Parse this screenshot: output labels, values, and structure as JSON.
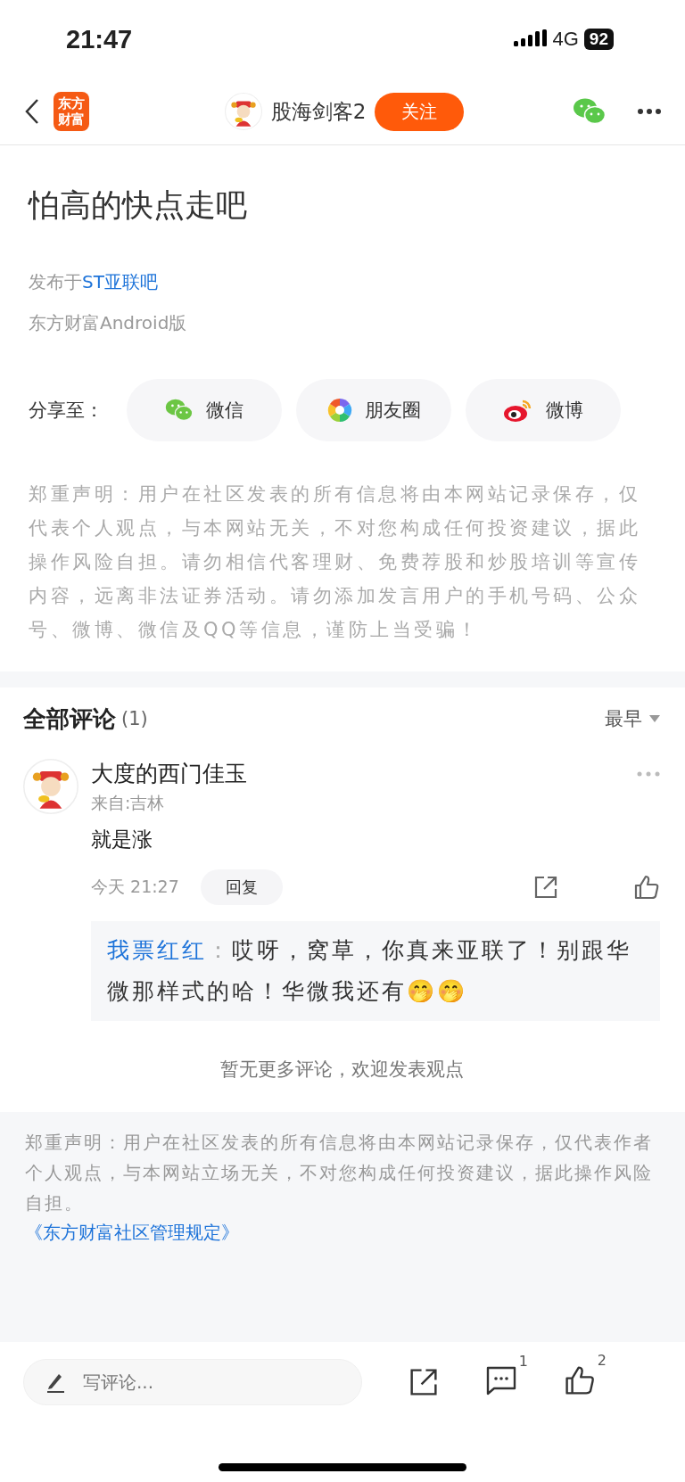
{
  "status_bar": {
    "time": "21:47",
    "network": "4G",
    "battery": "92"
  },
  "header": {
    "logo": "东方财富",
    "author": "股海剑客2",
    "follow_button": "关注"
  },
  "article": {
    "title_lines": [
      "怕高的快点走吧"
    ],
    "published_prefix": "发布于",
    "published_link": "ST亚联吧",
    "source": "东方财富Android版"
  },
  "share": {
    "label": "分享至：",
    "targets": [
      {
        "kind": "wechat",
        "label": "微信"
      },
      {
        "kind": "moments",
        "label": "朋友圈"
      },
      {
        "kind": "weibo",
        "label": "微博"
      }
    ]
  },
  "disclaimer": "郑重声明：用户在社区发表的所有信息将由本网站记录保存，仅代表个人观点，与本网站无关，不对您构成任何投资建议，据此操作风险自担。请勿相信代客理财、免费荐股和炒股培训等宣传内容，远离非法证券活动。请勿添加发言用户的手机号码、公众号、微博、微信及QQ等信息，谨防上当受骗！",
  "comments": {
    "title": "全部评论",
    "count": "(1)",
    "sort": "最早",
    "items": [
      {
        "author": "大度的西门佳玉",
        "location": "来自:吉林",
        "text": "就是涨",
        "time": "今天 21:27",
        "reply_button": "回复",
        "replies": [
          {
            "author": "我票红红",
            "separator": "：",
            "text": "哎呀，窝草，你真来亚联了！别跟华微那样式的哈！华微我还有🤭🤭"
          }
        ]
      }
    ],
    "empty_note": "暂无更多评论，欢迎发表观点"
  },
  "footer": {
    "disclaimer": "郑重声明：用户在社区发表的所有信息将由本网站记录保存，仅代表作者个人观点，与本网站立场无关，不对您构成任何投资建议，据此操作风险自担。",
    "rules_link": "《东方财富社区管理规定》"
  },
  "bottom_bar": {
    "placeholder": "写评论...",
    "comment_count": "1",
    "like_count": "2"
  }
}
